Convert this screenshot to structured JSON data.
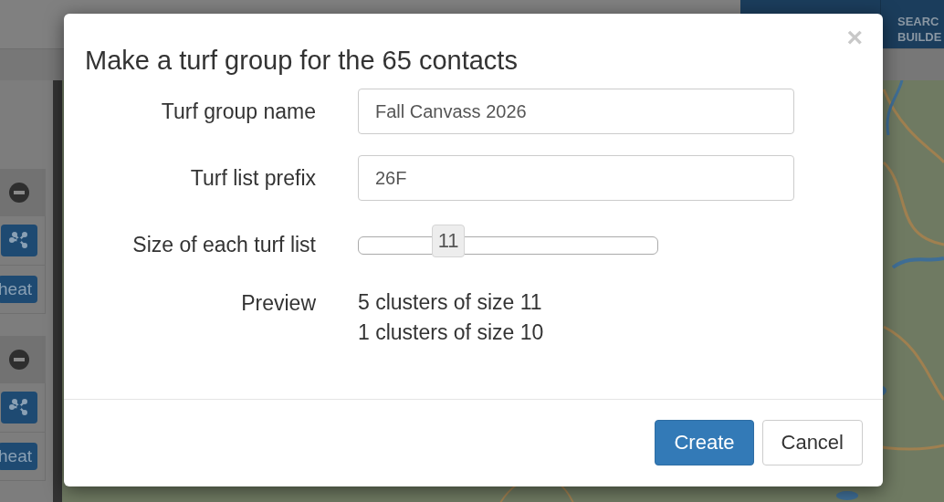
{
  "background": {
    "header_button": "SEARC BUILDE",
    "sidebar_groups": [
      {
        "action": "heat"
      },
      {
        "action": "heat"
      }
    ]
  },
  "dialog": {
    "title": "Make a turf group for the 65 contacts",
    "close": "×",
    "fields": [
      {
        "kind": "text",
        "label": "Turf group name",
        "value": "Fall Canvass 2026"
      },
      {
        "kind": "text",
        "label": "Turf list prefix",
        "value": "26F"
      },
      {
        "kind": "slider",
        "label": "Size of each turf list",
        "reading": "11",
        "level": 0.3
      },
      {
        "kind": "preview",
        "label": "Preview",
        "lines": [
          "5 clusters of size 11",
          "1 clusters of size 10"
        ]
      }
    ],
    "buttons": [
      {
        "label": "Create",
        "primary": true
      },
      {
        "label": "Cancel",
        "primary": false
      }
    ]
  }
}
